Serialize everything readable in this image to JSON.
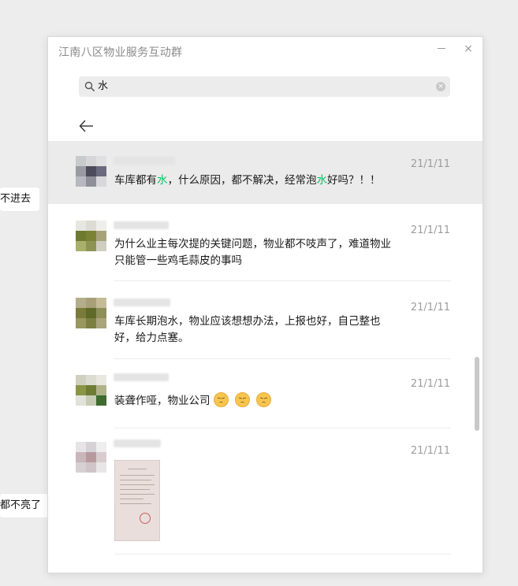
{
  "background": {
    "bubble_1": "不进去",
    "bubble_2": "都不亮了"
  },
  "window": {
    "title": "江南八区物业服务互动群",
    "minimize_label": "",
    "close_label": "×"
  },
  "search": {
    "query": "水",
    "clear_label": "×"
  },
  "results": [
    {
      "date": "21/1/11",
      "text_before": "车库都有",
      "highlight_1": "水",
      "text_middle": "，什么原因，都不解决，经常泡",
      "highlight_2": "水",
      "text_after": "好吗？！！"
    },
    {
      "date": "21/1/11",
      "text": "为什么业主每次提的关键问题，物业都不吱声了，难道物业只能管一些鸡毛蒜皮的事吗"
    },
    {
      "date": "21/1/11",
      "text": "车库长期泡水，物业应该想想办法，上报也好，自己整也好，给力点塞。"
    },
    {
      "date": "21/1/11",
      "text": "装聋作哑，物业公司"
    },
    {
      "date": "21/1/11"
    }
  ],
  "colors": {
    "highlight": "#07c160",
    "selected_row": "#ebebeb"
  }
}
